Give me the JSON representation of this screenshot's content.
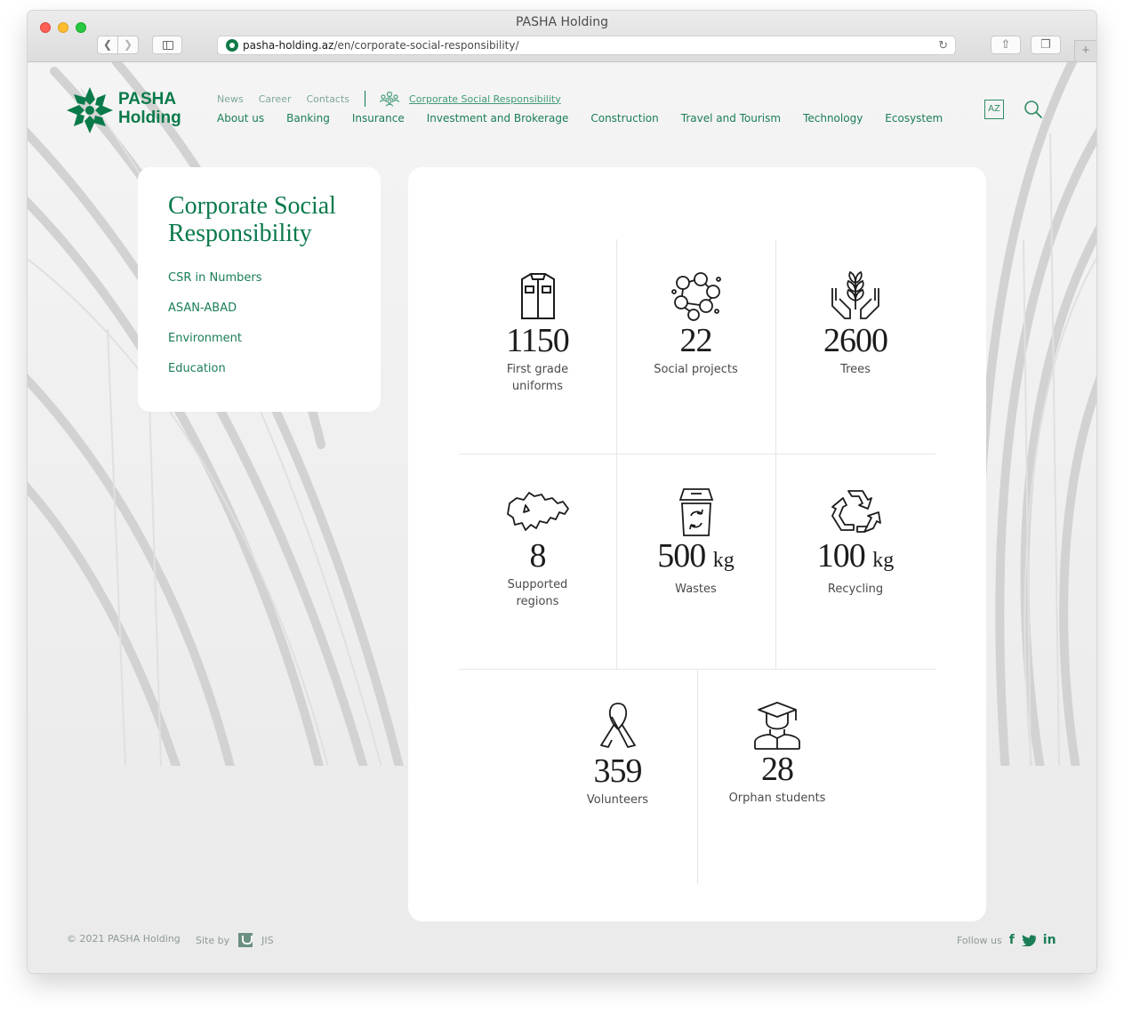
{
  "window": {
    "title": "PASHA Holding",
    "url_host": "pasha-holding.az",
    "url_path": "/en/corporate-social-responsibility/"
  },
  "brand": {
    "line1": "PASHA",
    "line2": "Holding",
    "color": "#0a7a4a"
  },
  "topnav": {
    "news": "News",
    "career": "Career",
    "contacts": "Contacts",
    "csr": "Corporate Social Responsibility"
  },
  "mainnav": [
    "About us",
    "Banking",
    "Insurance",
    "Investment and Brokerage",
    "Construction",
    "Travel and Tourism",
    "Technology",
    "Ecosystem"
  ],
  "lang": "AZ",
  "sidebar": {
    "title": "Corporate Social Responsibility",
    "items": [
      "CSR in Numbers",
      "ASAN-ABAD",
      "Environment",
      "Education"
    ]
  },
  "stats": [
    {
      "icon": "shirt-icon",
      "value": "1150",
      "unit": "",
      "label_line1": "First grade",
      "label_line2": "uniforms"
    },
    {
      "icon": "network-people-icon",
      "value": "22",
      "unit": "",
      "label_line1": "Social projects",
      "label_line2": ""
    },
    {
      "icon": "hands-plant-icon",
      "value": "2600",
      "unit": "",
      "label_line1": "Trees",
      "label_line2": ""
    },
    {
      "icon": "map-azerbaijan-icon",
      "value": "8",
      "unit": "",
      "label_line1": "Supported",
      "label_line2": "regions"
    },
    {
      "icon": "recycle-bin-icon",
      "value": "500",
      "unit": "kg",
      "label_line1": "Wastes",
      "label_line2": ""
    },
    {
      "icon": "recycle-icon",
      "value": "100",
      "unit": "kg",
      "label_line1": "Recycling",
      "label_line2": ""
    },
    {
      "icon": "ribbon-icon",
      "value": "359",
      "unit": "",
      "label_line1": "Volunteers",
      "label_line2": ""
    },
    {
      "icon": "graduate-icon",
      "value": "28",
      "unit": "",
      "label_line1": "Orphan students",
      "label_line2": ""
    }
  ],
  "footer": {
    "copyright": "© 2021 PASHA Holding",
    "site_by": "Site by",
    "agency": "JIS",
    "follow_us": "Follow us",
    "social": [
      "f",
      "t",
      "in"
    ]
  }
}
